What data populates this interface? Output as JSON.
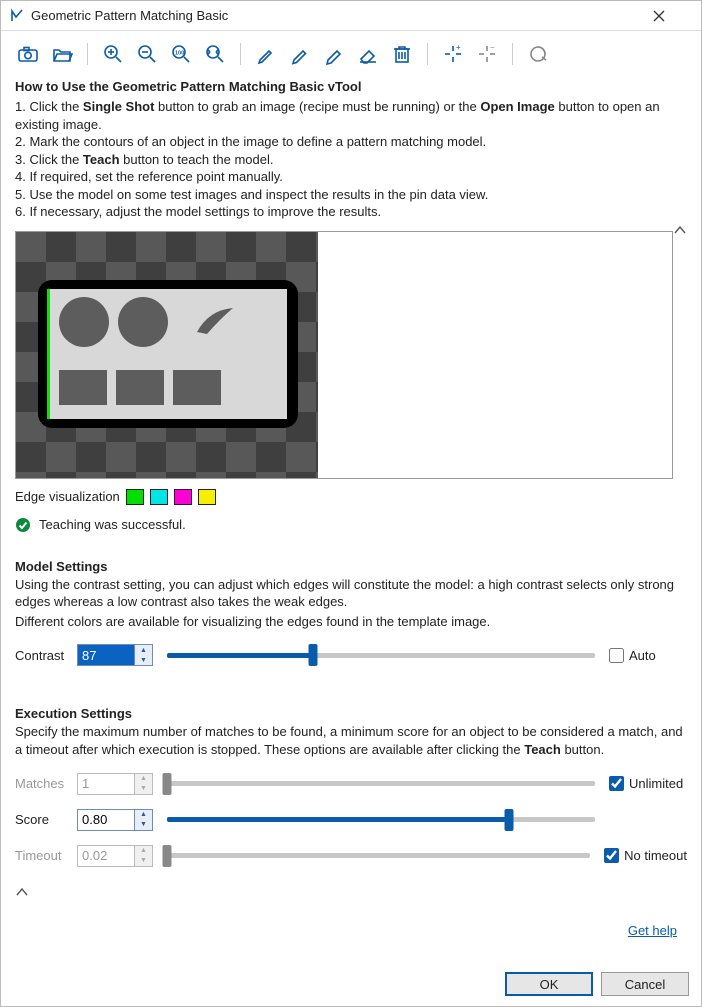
{
  "window": {
    "title": "Geometric Pattern Matching Basic"
  },
  "toolbar": {
    "icons": [
      "camera",
      "open",
      "zoom-in",
      "zoom-out",
      "zoom-100",
      "zoom-fit",
      "pencil-1",
      "pencil-2",
      "pencil-3",
      "eraser",
      "trash",
      "crosshair-1",
      "crosshair-2",
      "teach"
    ]
  },
  "howto": {
    "title": "How to Use the Geometric Pattern Matching Basic vTool",
    "line1_a": "1. Click the ",
    "line1_b": "Single Shot",
    "line1_c": " button to grab an image (recipe must be running) or the ",
    "line1_d": "Open Image",
    "line1_e": " button to open an existing image.",
    "line2": "2. Mark the contours of an object in the image to define a pattern matching model.",
    "line3_a": "3. Click the ",
    "line3_b": "Teach",
    "line3_c": " button to teach the model.",
    "line4": "4. If required, set the reference point manually.",
    "line5": "5. Use the model on some test images and inspect the results in the pin data view.",
    "line6": "6. If necessary, adjust the model settings to improve the results."
  },
  "edge_visualization": {
    "label": "Edge visualization",
    "colors": [
      "#00e000",
      "#00e6e6",
      "#ff00d8",
      "#f6f000"
    ]
  },
  "status": {
    "text": "Teaching was successful."
  },
  "model_settings": {
    "title": "Model Settings",
    "desc1": "Using the contrast setting, you can adjust which edges will constitute the model: a high contrast selects only strong edges whereas a low contrast also takes the weak edges.",
    "desc2": "Different colors are available for visualizing the edges found in the template image.",
    "contrast_label": "Contrast",
    "contrast_value": "87",
    "contrast_pct": 34,
    "auto_label": "Auto",
    "auto_checked": false
  },
  "execution_settings": {
    "title": "Execution Settings",
    "desc_a": "Specify the maximum number of matches to be found, a minimum score for an object to be considered a match, and a timeout after which execution is stopped. These options are available after clicking the ",
    "desc_b": "Teach",
    "desc_c": " button.",
    "matches_label": "Matches",
    "matches_value": "1",
    "matches_pct": 0,
    "unlimited_label": "Unlimited",
    "unlimited_checked": true,
    "score_label": "Score",
    "score_value": "0.80",
    "score_pct": 80,
    "timeout_label": "Timeout",
    "timeout_value": "0.02",
    "timeout_pct": 0,
    "notimeout_label": "No timeout",
    "notimeout_checked": true
  },
  "help": {
    "label": "Get help"
  },
  "footer": {
    "ok": "OK",
    "cancel": "Cancel"
  }
}
